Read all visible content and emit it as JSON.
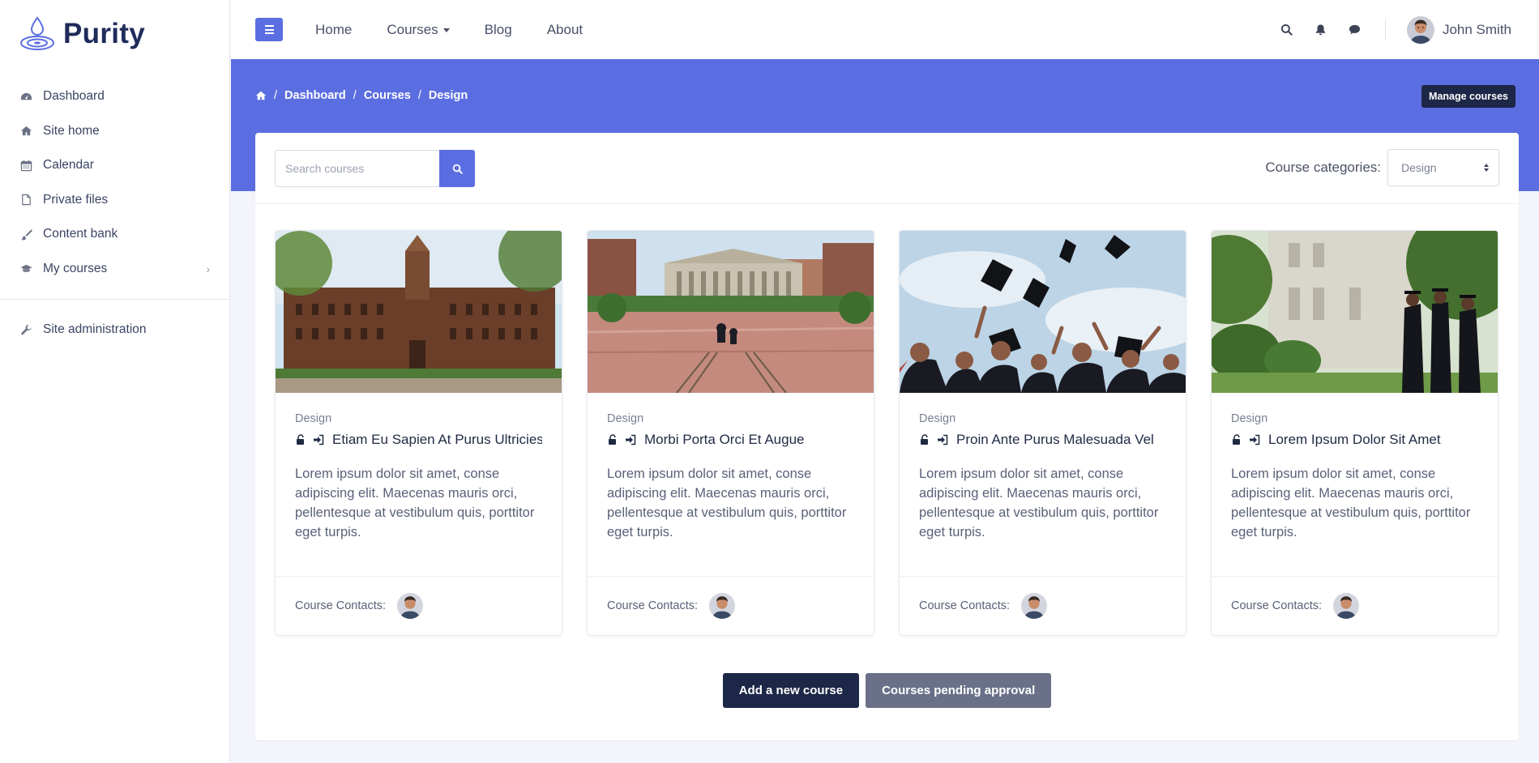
{
  "brand": {
    "name": "Purity",
    "logo_icon": "water-drop-logo-icon",
    "accent": "#5b6ee1",
    "dark": "#1d2747"
  },
  "sidebar": {
    "items": [
      {
        "label": "Dashboard",
        "icon": "dashboard-icon"
      },
      {
        "label": "Site home",
        "icon": "home-icon"
      },
      {
        "label": "Calendar",
        "icon": "calendar-icon"
      },
      {
        "label": "Private files",
        "icon": "file-icon"
      },
      {
        "label": "Content bank",
        "icon": "brush-icon"
      },
      {
        "label": "My courses",
        "icon": "graduation-cap-icon",
        "has_children": true
      }
    ],
    "admin": {
      "label": "Site administration",
      "icon": "wrench-icon"
    }
  },
  "topbar": {
    "links": [
      {
        "label": "Home"
      },
      {
        "label": "Courses",
        "dropdown": true
      },
      {
        "label": "Blog"
      },
      {
        "label": "About"
      }
    ],
    "icons": [
      "search-icon",
      "bell-icon",
      "chat-icon"
    ],
    "user": {
      "name": "John Smith"
    }
  },
  "breadcrumb": {
    "items": [
      "Dashboard",
      "Courses",
      "Design"
    ],
    "separator": "/"
  },
  "header": {
    "manage_label": "Manage courses"
  },
  "search": {
    "placeholder": "Search courses"
  },
  "categories": {
    "label": "Course categories:",
    "selected": "Design"
  },
  "courses": [
    {
      "category": "Design",
      "title": "Etiam Eu Sapien At Purus Ultricies",
      "description": "Lorem ipsum dolor sit amet, conse adipiscing elit. Maecenas mauris orci, pellentesque at vestibulum quis, porttitor eget turpis.",
      "contacts_label": "Course Contacts:"
    },
    {
      "category": "Design",
      "title": "Morbi Porta Orci Et Augue",
      "description": "Lorem ipsum dolor sit amet, conse adipiscing elit. Maecenas mauris orci, pellentesque at vestibulum quis, porttitor eget turpis.",
      "contacts_label": "Course Contacts:"
    },
    {
      "category": "Design",
      "title": "Proin Ante Purus Malesuada Vel",
      "description": "Lorem ipsum dolor sit amet, conse adipiscing elit. Maecenas mauris orci, pellentesque at vestibulum quis, porttitor eget turpis.",
      "contacts_label": "Course Contacts:"
    },
    {
      "category": "Design",
      "title": "Lorem Ipsum Dolor Sit Amet",
      "description": "Lorem ipsum dolor sit amet, conse adipiscing elit. Maecenas mauris orci, pellentesque at vestibulum quis, porttitor eget turpis.",
      "contacts_label": "Course Contacts:"
    }
  ],
  "actions": {
    "add_label": "Add a new course",
    "pending_label": "Courses pending approval"
  }
}
